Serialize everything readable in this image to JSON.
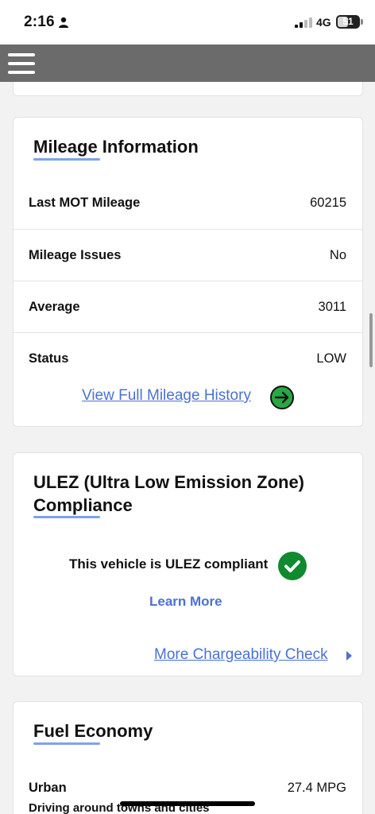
{
  "status_bar": {
    "time": "2:16",
    "network": "4G",
    "battery": "51"
  },
  "mileage": {
    "title": "Mileage Information",
    "rows": [
      {
        "label": "Last MOT Mileage",
        "value": "60215"
      },
      {
        "label": "Mileage Issues",
        "value": "No"
      },
      {
        "label": "Average",
        "value": "3011"
      },
      {
        "label": "Status",
        "value": "LOW"
      }
    ],
    "history_link": "View Full Mileage History"
  },
  "ulez": {
    "title_line1": "ULEZ (Ultra Low Emission Zone)",
    "title_line2": "Compliance",
    "compliance_text": "This vehicle is ULEZ compliant",
    "learn_more": "Learn More",
    "chargeability_link": "More Chargeability Check"
  },
  "fuel": {
    "title": "Fuel Economy",
    "rows": [
      {
        "label": "Urban",
        "sublabel": "Driving around towns and cities",
        "value": "27.4 MPG"
      }
    ]
  },
  "colors": {
    "accent_link": "#4a72d4",
    "underline": "#7ea1ef",
    "success_green": "#108a2e",
    "navbar": "#6b6b6b"
  },
  "icons": [
    "person-icon",
    "signal-icon",
    "battery-icon",
    "menu-icon",
    "arrow-right-icon",
    "check-icon",
    "play-icon"
  ]
}
